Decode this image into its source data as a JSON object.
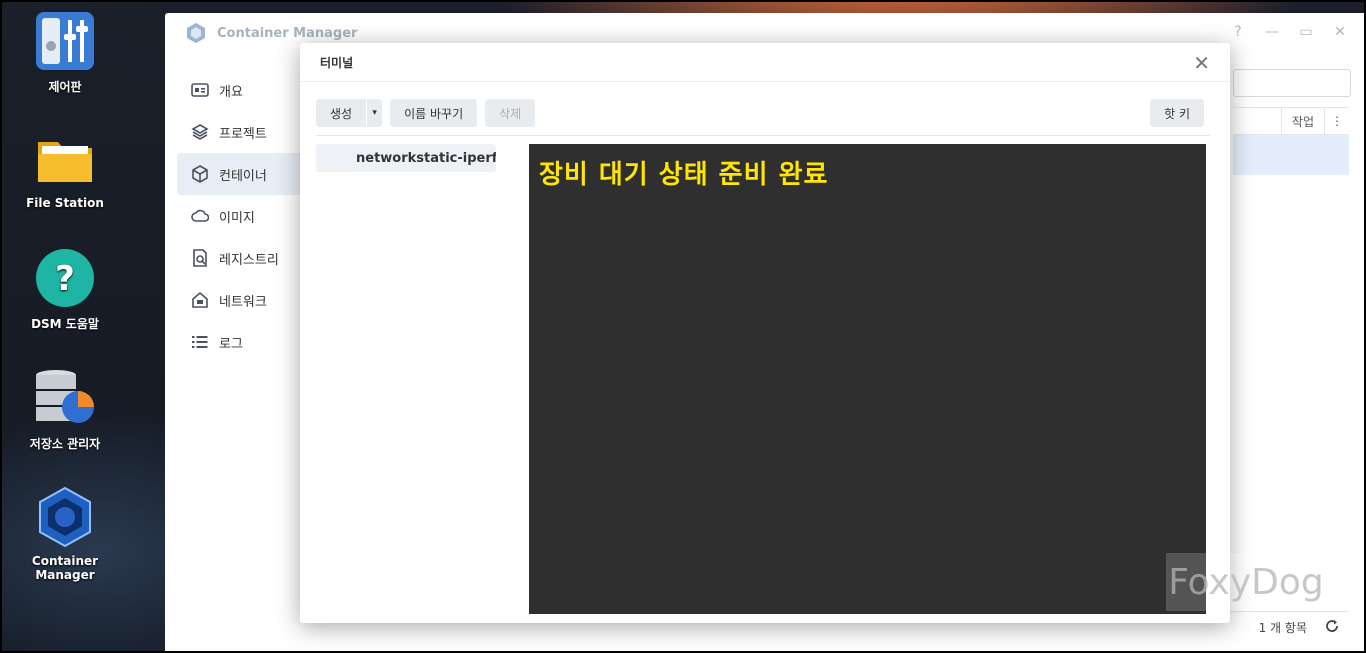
{
  "desktop": {
    "icons": [
      {
        "label": "제어판",
        "icon": "control-panel-icon"
      },
      {
        "label": "File Station",
        "icon": "folder-icon"
      },
      {
        "label": "DSM 도움말",
        "icon": "help-icon"
      },
      {
        "label": "저장소 관리자",
        "icon": "storage-manager-icon"
      },
      {
        "label": "Container Manager",
        "icon": "container-manager-icon"
      }
    ]
  },
  "window": {
    "title": "Container Manager",
    "controls": {
      "help": "?",
      "minimize": "—",
      "maximize": "▭",
      "close": "✕"
    },
    "sidebar": {
      "items": [
        {
          "label": "개요",
          "icon": "overview-icon"
        },
        {
          "label": "프로젝트",
          "icon": "project-icon"
        },
        {
          "label": "컨테이너",
          "icon": "container-icon",
          "active": true
        },
        {
          "label": "이미지",
          "icon": "image-icon"
        },
        {
          "label": "레지스트리",
          "icon": "registry-icon"
        },
        {
          "label": "네트워크",
          "icon": "network-icon"
        },
        {
          "label": "로그",
          "icon": "log-icon"
        }
      ]
    },
    "table": {
      "header_action": "작업",
      "header_more": "⋮"
    },
    "footer": {
      "count": "1 개 항목",
      "refresh_icon": "refresh-icon"
    }
  },
  "dialog": {
    "title": "터미널",
    "close": "✕",
    "toolbar": {
      "create": "생성",
      "caret": "▾",
      "rename": "이름 바꾸기",
      "delete": "삭제",
      "hotkey": "핫 키"
    },
    "sessions": [
      "networkstatic-iperf"
    ],
    "terminal_text": "장비 대기 상태 준비 완료"
  },
  "watermark": "FoxyDog",
  "colors": {
    "terminal_bg": "#2f2f2f",
    "terminal_text": "#ffe600",
    "active_item_bg": "#e8eef5"
  }
}
